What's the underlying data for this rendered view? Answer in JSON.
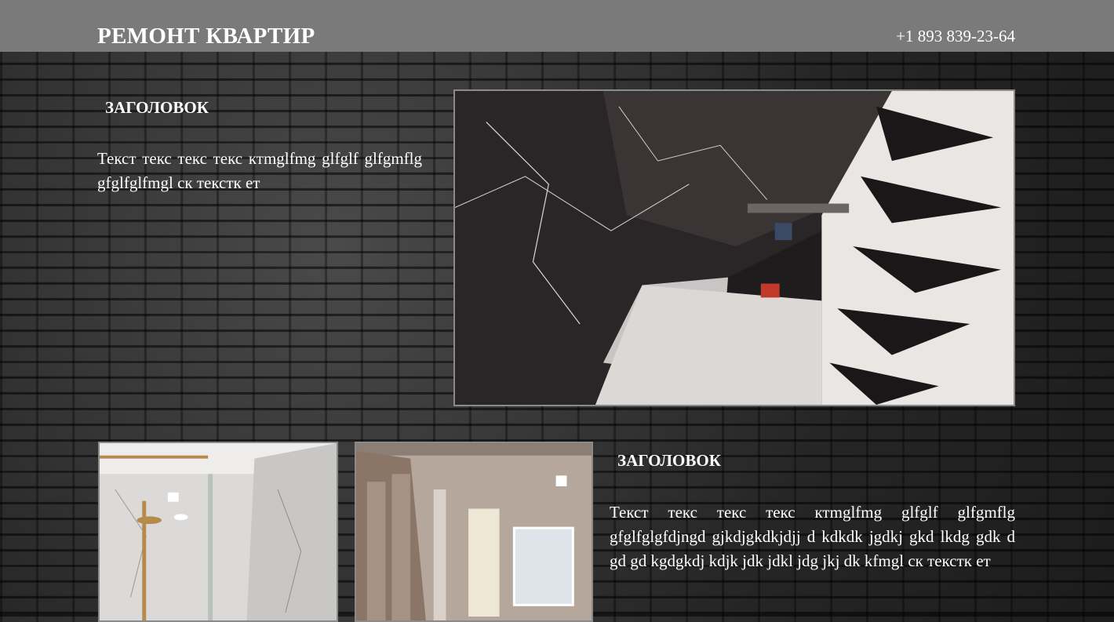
{
  "header": {
    "title": "РЕМОНТ КВАРТИР",
    "phone": "+1 893 839-23-64"
  },
  "section1": {
    "heading": "ЗАГОЛОВОК",
    "text": "Текст текс текс текс ктmglfmg glfglf glfgmflg gfglfglfmgl ск текстк ет"
  },
  "section2": {
    "heading": "ЗАГОЛОВОК",
    "text": "Текст текс текс текс ктmglfmg glfglf glfgmflg gfglfglgfdjngd gjkdjgkdkjdjj d kdkdk jgdkj gkd lkdg gdk d gd gd kgdgkdj kdjk jdk jdkl jdg jkj dk kfmgl ск текстк ет"
  }
}
